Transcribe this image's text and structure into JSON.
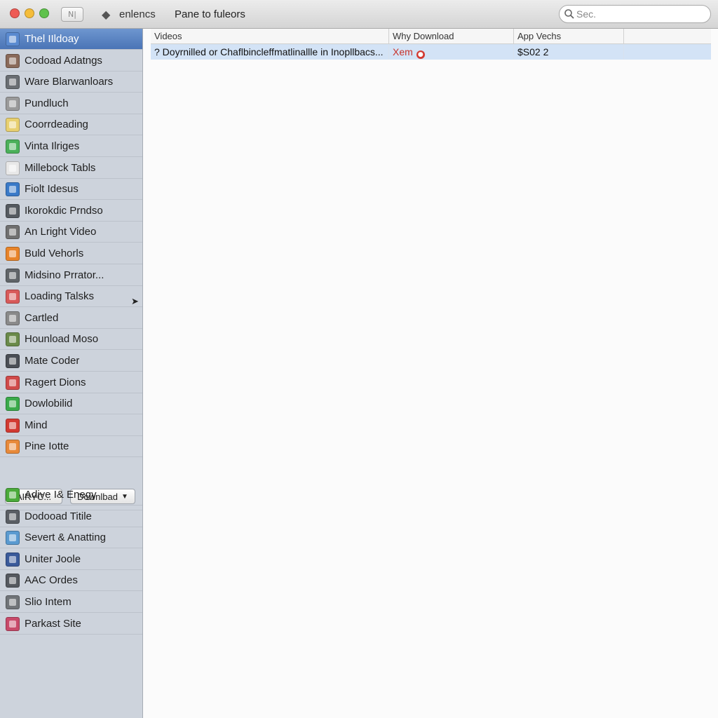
{
  "toolbar": {
    "view_toggle_label": "N|",
    "crumb": "enlencs",
    "title": "Pane to fuleors",
    "search_placeholder": "Sec."
  },
  "sidebar": {
    "items": [
      {
        "label": "Thel IIldoay",
        "icon": "folder-icon",
        "color": "#5a8ad0",
        "selected": true
      },
      {
        "label": "Codoad Adatngs",
        "icon": "drive-icon",
        "color": "#8a6a5a"
      },
      {
        "label": "Ware Blarwanloars",
        "icon": "lock-icon",
        "color": "#6a6e73"
      },
      {
        "label": "Pundluch",
        "icon": "printer-icon",
        "color": "#9a9a9a"
      },
      {
        "label": "Coorrdeading",
        "icon": "note-icon",
        "color": "#e8d070"
      },
      {
        "label": "Vinta Ilriges",
        "icon": "photo-icon",
        "color": "#4bb05a"
      },
      {
        "label": "Millebock Tabls",
        "icon": "document-icon",
        "color": "#e8e8e8"
      },
      {
        "label": "Fiolt Idesus",
        "icon": "globe-icon",
        "color": "#3a7ac8"
      },
      {
        "label": "Ikorokdic Prndso",
        "icon": "film-icon",
        "color": "#555a60"
      },
      {
        "label": "An Lright Video",
        "icon": "camera-icon",
        "color": "#707070"
      },
      {
        "label": "Buld Vehorls",
        "icon": "package-icon",
        "color": "#e8842a"
      },
      {
        "label": "Midsino Prrator...",
        "icon": "monitor-icon",
        "color": "#606468"
      },
      {
        "label": "Loading Talsks",
        "icon": "tools-icon",
        "color": "#d85a5a"
      },
      {
        "label": "Cartled",
        "icon": "calendar-icon",
        "color": "#8a8a8a"
      },
      {
        "label": "Hounload Moso",
        "icon": "mug-icon",
        "color": "#6a8a4a"
      },
      {
        "label": "Mate Coder",
        "icon": "terminal-icon",
        "color": "#4a4e55"
      },
      {
        "label": "Ragert Dions",
        "icon": "clipboard-icon",
        "color": "#d04a4a"
      },
      {
        "label": "Dowlobilid",
        "icon": "upload-arrow-icon",
        "color": "#3aaa4a"
      },
      {
        "label": "Mind",
        "icon": "music-icon",
        "color": "#d23a32"
      },
      {
        "label": "Pine Iotte",
        "icon": "puzzle-icon",
        "color": "#e88a3a"
      }
    ],
    "items_after": [
      {
        "label": "Adive I& Enegy",
        "icon": "power-icon",
        "color": "#4aaa3a"
      },
      {
        "label": "Dodooad Titile",
        "icon": "book-icon",
        "color": "#5a5e64"
      },
      {
        "label": "Severt & Anatting",
        "icon": "map-icon",
        "color": "#5a9ad0"
      },
      {
        "label": "Uniter Joole",
        "icon": "grid-icon",
        "color": "#3a5a9a"
      },
      {
        "label": "AAC Ordes",
        "icon": "speaker-icon",
        "color": "#55595f"
      },
      {
        "label": "Slio Intem",
        "icon": "gear-icon",
        "color": "#707478"
      },
      {
        "label": "Parkast Site",
        "icon": "bookmark-icon",
        "color": "#c84a6a"
      }
    ],
    "button_left": "AIRYC...",
    "button_right": "Downlbad",
    "button_right_caret": "▼"
  },
  "table": {
    "headers": [
      "Videos",
      "Why Download",
      "App Vechs",
      ""
    ],
    "rows": [
      {
        "c1": "? Doyrnilled or Chaflbincleffmatlinallle in Inopllbacs...",
        "c2": "Xem",
        "c3": "$S02 2",
        "c4": ""
      }
    ]
  },
  "colors": {
    "sidebar_bg": "#cdd3dc",
    "selection": "#4a74b6",
    "row_highlight": "#d3e3f6",
    "status_red": "#c8322a"
  }
}
